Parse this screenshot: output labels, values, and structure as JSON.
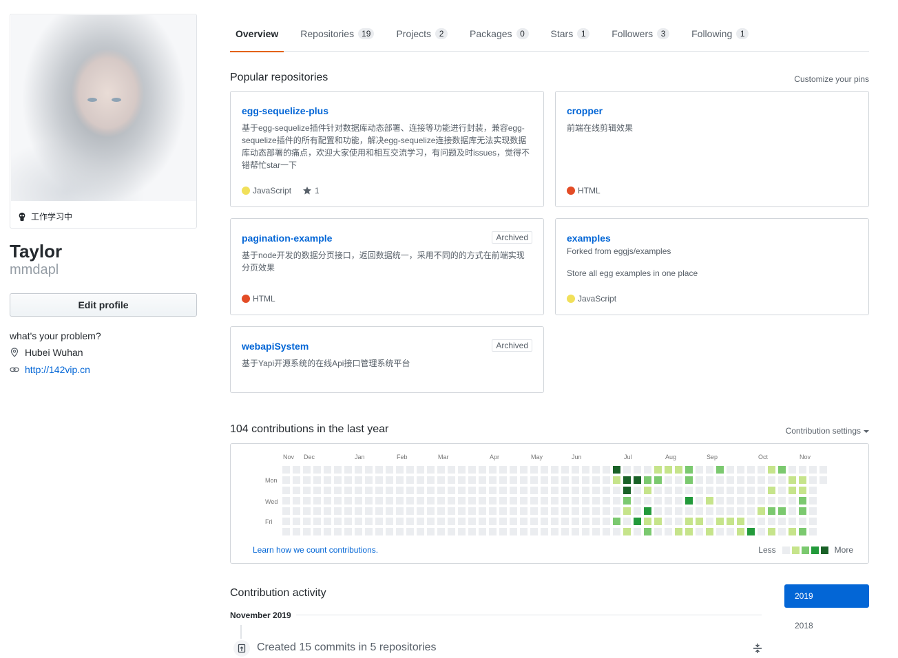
{
  "profile": {
    "status": "工作学习中",
    "name": "Taylor",
    "login": "mmdapl",
    "edit_label": "Edit profile",
    "bio": "what's your problem?",
    "location": "Hubei Wuhan",
    "website": "http://142vip.cn"
  },
  "tabs": [
    {
      "label": "Overview",
      "count": null
    },
    {
      "label": "Repositories",
      "count": "19"
    },
    {
      "label": "Projects",
      "count": "2"
    },
    {
      "label": "Packages",
      "count": "0"
    },
    {
      "label": "Stars",
      "count": "1"
    },
    {
      "label": "Followers",
      "count": "3"
    },
    {
      "label": "Following",
      "count": "1"
    }
  ],
  "pinned": {
    "title": "Popular repositories",
    "customize": "Customize your pins",
    "repos": [
      {
        "name": "egg-sequelize-plus",
        "desc": "基于egg-sequelize插件针对数据库动态部署、连接等功能进行封装，兼容egg-sequelize插件的所有配置和功能，解决egg-sequelize连接数据库无法实现数据库动态部署的痛点，欢迎大家使用和相互交流学习，有问题及时issues，觉得不错帮忙star一下",
        "lang": "JavaScript",
        "lang_color": "#f1e05a",
        "stars": "1",
        "archived": ""
      },
      {
        "name": "cropper",
        "desc": "前端在线剪辑效果",
        "lang": "HTML",
        "lang_color": "#e34c26",
        "stars": "",
        "archived": ""
      },
      {
        "name": "pagination-example",
        "desc": "基于node开发的数据分页接口，返回数据统一，采用不同的的方式在前端实现分页效果",
        "lang": "HTML",
        "lang_color": "#e34c26",
        "stars": "",
        "archived": "Archived"
      },
      {
        "name": "examples",
        "forked": "Forked from eggjs/examples",
        "desc": "Store all egg examples in one place",
        "lang": "JavaScript",
        "lang_color": "#f1e05a",
        "stars": "",
        "archived": ""
      },
      {
        "name": "webapiSystem",
        "desc": "基于Yapi开源系统的在线Api接口管理系统平台",
        "lang": "",
        "lang_color": "",
        "stars": "",
        "archived": "Archived"
      }
    ]
  },
  "contributions": {
    "title": "104 contributions in the last year",
    "settings": "Contribution settings",
    "months": [
      "Nov",
      "Dec",
      "Jan",
      "Feb",
      "Mar",
      "Apr",
      "May",
      "Jun",
      "Jul",
      "Aug",
      "Sep",
      "Oct",
      "Nov"
    ],
    "weekdays": [
      "Mon",
      "Wed",
      "Fri"
    ],
    "learn_link": "Learn how we count contributions.",
    "legend_less": "Less",
    "legend_more": "More",
    "colors": [
      "#ebedf0",
      "#c6e48b",
      "#7bc96f",
      "#239a3b",
      "#196127"
    ]
  },
  "activity": {
    "title": "Contribution activity",
    "month": "November 2019",
    "item": "Created 15 commits in 5 repositories",
    "years": [
      "2019",
      "2018"
    ]
  }
}
